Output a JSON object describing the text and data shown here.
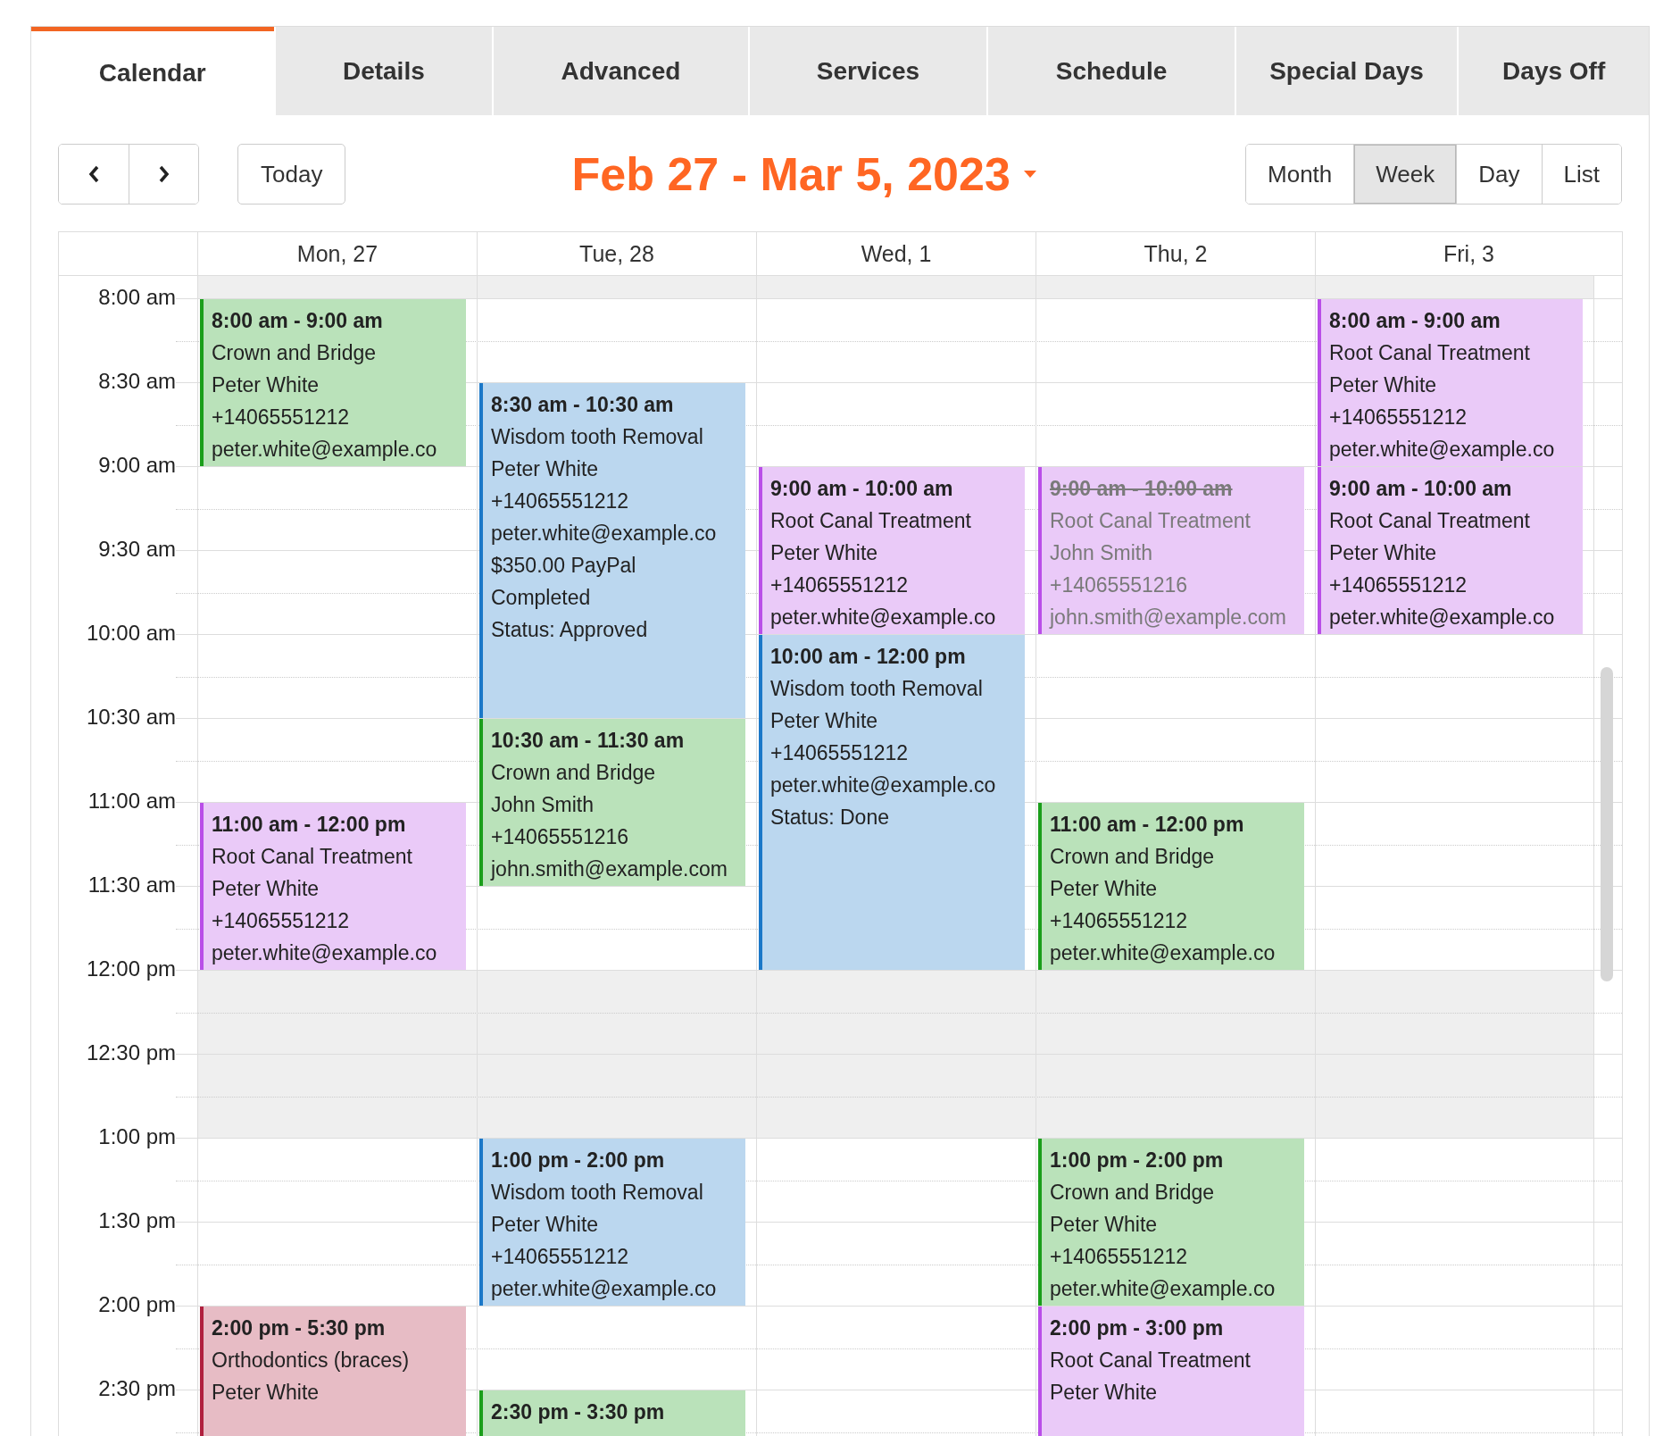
{
  "tabs": [
    {
      "label": "Calendar",
      "selected": true
    },
    {
      "label": "Details",
      "selected": false
    },
    {
      "label": "Advanced",
      "selected": false
    },
    {
      "label": "Services",
      "selected": false
    },
    {
      "label": "Schedule",
      "selected": false
    },
    {
      "label": "Special Days",
      "selected": false
    },
    {
      "label": "Days Off",
      "selected": false
    }
  ],
  "toolbar": {
    "today": "Today",
    "title": "Feb 27 - Mar 5, 2023",
    "views": [
      {
        "label": "Month",
        "selected": false
      },
      {
        "label": "Week",
        "selected": true
      },
      {
        "label": "Day",
        "selected": false
      },
      {
        "label": "List",
        "selected": false
      }
    ]
  },
  "calendar": {
    "time_slots": [
      {
        "label": "8:00 am",
        "closed": false
      },
      {
        "label": "8:30 am",
        "closed": false
      },
      {
        "label": "9:00 am",
        "closed": false
      },
      {
        "label": "9:30 am",
        "closed": false
      },
      {
        "label": "10:00 am",
        "closed": false
      },
      {
        "label": "10:30 am",
        "closed": false
      },
      {
        "label": "11:00 am",
        "closed": false
      },
      {
        "label": "11:30 am",
        "closed": false
      },
      {
        "label": "12:00 pm",
        "closed": true
      },
      {
        "label": "12:30 pm",
        "closed": true
      },
      {
        "label": "1:00 pm",
        "closed": false
      },
      {
        "label": "1:30 pm",
        "closed": false
      },
      {
        "label": "2:00 pm",
        "closed": false
      },
      {
        "label": "2:30 pm",
        "closed": false
      }
    ],
    "days": [
      {
        "label": "Mon, 27",
        "events": [
          {
            "time": "8:00 am - 9:00 am",
            "cancelled": false,
            "color": "#1a9e1a",
            "lines": [
              "Crown and Bridge",
              "Peter White",
              "+14065551212",
              "peter.white@example.co"
            ]
          },
          {
            "time": "11:00 am - 12:00 pm",
            "cancelled": false,
            "color": "#b94ee8",
            "lines": [
              "Root Canal Treatment",
              "Peter White",
              "+14065551212",
              "peter.white@example.co"
            ]
          },
          {
            "time": "2:00 pm - 5:30 pm",
            "cancelled": false,
            "color": "#b0203e",
            "lines": [
              "Orthodontics (braces)",
              "Peter White"
            ]
          }
        ]
      },
      {
        "label": "Tue, 28",
        "events": [
          {
            "time": "8:30 am - 10:30 am",
            "cancelled": false,
            "color": "#1b78c8",
            "lines": [
              "Wisdom tooth Removal",
              "Peter White",
              "+14065551212",
              "peter.white@example.co",
              "$350.00 PayPal",
              "Completed",
              "Status: Approved"
            ]
          },
          {
            "time": "10:30 am - 11:30 am",
            "cancelled": false,
            "color": "#1a9e1a",
            "lines": [
              "Crown and Bridge",
              "John Smith",
              "+14065551216",
              "john.smith@example.com"
            ]
          },
          {
            "time": "1:00 pm - 2:00 pm",
            "cancelled": false,
            "color": "#1b78c8",
            "lines": [
              "Wisdom tooth Removal",
              "Peter White",
              "+14065551212",
              "peter.white@example.co"
            ]
          },
          {
            "time": "2:30 pm - 3:30 pm",
            "cancelled": false,
            "color": "#1a9e1a"
          }
        ]
      },
      {
        "label": "Wed, 1",
        "events": [
          {
            "time": "9:00 am - 10:00 am",
            "cancelled": false,
            "color": "#b94ee8",
            "lines": [
              "Root Canal Treatment",
              "Peter White",
              "+14065551212",
              "peter.white@example.co"
            ]
          },
          {
            "time": "10:00 am - 12:00 pm",
            "cancelled": false,
            "color": "#1b78c8",
            "lines": [
              "Wisdom tooth Removal",
              "Peter White",
              "+14065551212",
              "peter.white@example.co",
              "Status: Done"
            ]
          }
        ]
      },
      {
        "label": "Thu, 2",
        "events": [
          {
            "time": "9:00 am - 10:00 am",
            "cancelled": true,
            "color": "#b94ee8",
            "lines": [
              "Root Canal Treatment",
              "John Smith",
              "+14065551216",
              "john.smith@example.com"
            ]
          },
          {
            "time": "11:00 am - 12:00 pm",
            "cancelled": false,
            "color": "#1a9e1a",
            "lines": [
              "Crown and Bridge",
              "Peter White",
              "+14065551212",
              "peter.white@example.co"
            ]
          },
          {
            "time": "1:00 pm - 2:00 pm",
            "cancelled": false,
            "color": "#1a9e1a",
            "lines": [
              "Crown and Bridge",
              "Peter White",
              "+14065551212",
              "peter.white@example.co"
            ]
          },
          {
            "time": "2:00 pm - 3:00 pm",
            "cancelled": false,
            "color": "#b94ee8",
            "lines": [
              "Root Canal Treatment",
              "Peter White"
            ]
          }
        ]
      },
      {
        "label": "Fri, 3",
        "events": [
          {
            "time": "8:00 am - 9:00 am",
            "cancelled": false,
            "color": "#b94ee8",
            "lines": [
              "Root Canal Treatment",
              "Peter White",
              "+14065551212",
              "peter.white@example.co"
            ]
          },
          {
            "time": "9:00 am - 10:00 am",
            "cancelled": false,
            "color": "#b94ee8",
            "lines": [
              "Root Canal Treatment",
              "Peter White",
              "+14065551212",
              "peter.white@example.co"
            ]
          }
        ]
      }
    ]
  }
}
